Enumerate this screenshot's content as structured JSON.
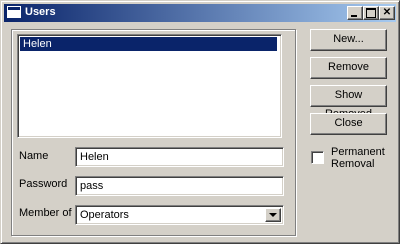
{
  "window": {
    "title": "Users",
    "controls": {
      "minimize": "",
      "maximize": "",
      "close": "✕"
    }
  },
  "users_list": {
    "items": [
      "Helen"
    ],
    "selected_index": 0
  },
  "form": {
    "name_label": "Name",
    "name_value": "Helen",
    "password_label": "Password",
    "password_value": "pass",
    "member_of_label": "Member of",
    "member_of_value": "Operators"
  },
  "buttons": {
    "new": "New...",
    "remove": "Remove",
    "show_removed": "Show Removed",
    "close": "Close"
  },
  "permanent_removal": {
    "label": "Permanent Removal",
    "checked": false
  },
  "colors": {
    "title_bar_start": "#0a246a",
    "title_bar_end": "#a6caf0",
    "selection": "#0a246a",
    "face": "#d4d0c8"
  }
}
